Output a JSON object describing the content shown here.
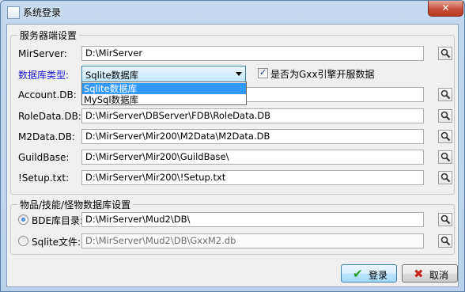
{
  "window": {
    "title": "系统登录",
    "close_glyph": "✕"
  },
  "server_group": {
    "title": "服务器端设置",
    "mirserver": {
      "label": "MirServer:",
      "value": "D:\\MirServer"
    },
    "db_type": {
      "label": "数据库类型:",
      "selected": "Sqlite数据库",
      "options": [
        "Sqlite数据库",
        "MySql数据库"
      ],
      "label_color": "#1a1ad6"
    },
    "gxx_checkbox": {
      "label": "是否为Gxx引擎开服数据",
      "checked": true
    },
    "account_db": {
      "label": "Account.DB:",
      "value": ""
    },
    "roledata_db": {
      "label": "RoleData.DB:",
      "value": "D:\\MirServer\\DBServer\\FDB\\RoleData.DB"
    },
    "m2data_db": {
      "label": "M2Data.DB:",
      "value": "D:\\MirServer\\Mir200\\M2Data\\M2Data.DB"
    },
    "guildbase": {
      "label": "GuildBase:",
      "value": "D:\\MirServer\\Mir200\\GuildBase\\"
    },
    "setup_txt": {
      "label": "!Setup.txt:",
      "value": "D:\\MirServer\\Mir200\\!Setup.txt"
    }
  },
  "item_group": {
    "title": "物品/技能/怪物数据库设置",
    "bde_dir": {
      "label": "BDE库目录:",
      "value": "D:\\MirServer\\Mud2\\DB\\",
      "selected": true
    },
    "sqlite_file": {
      "label": "Sqlite文件:",
      "value": "D:\\MirServer\\Mud2\\DB\\GxxM2.db",
      "selected": false
    }
  },
  "buttons": {
    "login": "登录",
    "cancel": "取消",
    "login_icon": "✔",
    "cancel_icon": "✖"
  },
  "colors": {
    "accent_label": "#1a1ad6",
    "check_green": "#1f9a28",
    "cancel_red": "#c4261d"
  }
}
